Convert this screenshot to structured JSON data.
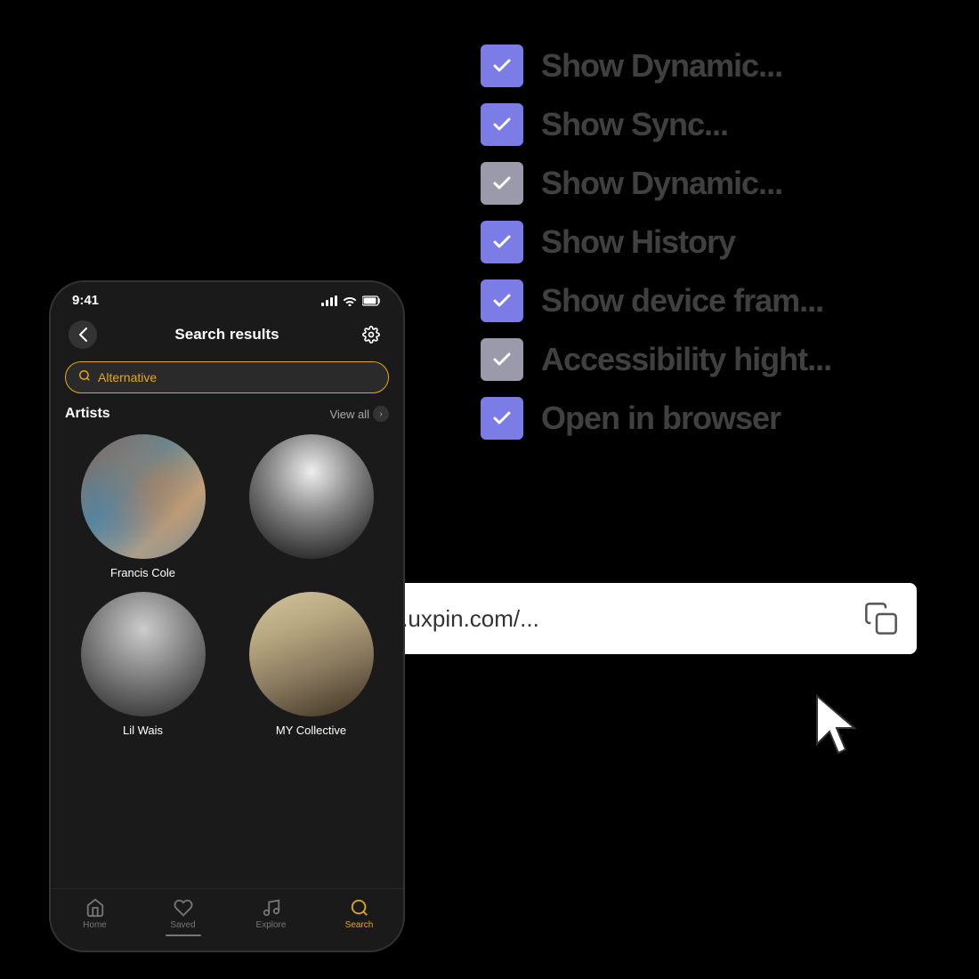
{
  "background": "#000000",
  "checkboxList": {
    "items": [
      {
        "id": 1,
        "label": "Show Dynamic...",
        "checked": true,
        "colorClass": "purple"
      },
      {
        "id": 2,
        "label": "Show Sync...",
        "checked": true,
        "colorClass": "purple"
      },
      {
        "id": 3,
        "label": "Show Dynamic...",
        "checked": true,
        "colorClass": "grey"
      },
      {
        "id": 4,
        "label": "Show History",
        "checked": true,
        "colorClass": "purple"
      },
      {
        "id": 5,
        "label": "Show device fram...",
        "checked": true,
        "colorClass": "purple"
      },
      {
        "id": 6,
        "label": "Accessibility hight...",
        "checked": true,
        "colorClass": "grey"
      },
      {
        "id": 7,
        "label": "Open in browser",
        "checked": true,
        "colorClass": "purple"
      }
    ]
  },
  "urlBar": {
    "url": "https://preview.uxpin.com/...",
    "copyIcon": "copy"
  },
  "phone": {
    "statusBar": {
      "time": "9:41",
      "signal": true,
      "wifi": true,
      "battery": true
    },
    "header": {
      "title": "Search results",
      "backButton": "‹",
      "settingsIcon": "⚙"
    },
    "searchBar": {
      "placeholder": "Alternative",
      "icon": "🔍"
    },
    "artists": {
      "sectionTitle": "Artists",
      "viewAll": "View all",
      "items": [
        {
          "name": "Francis Cole",
          "avatarType": "fc"
        },
        {
          "name": "",
          "avatarType": "b2"
        },
        {
          "name": "Lil Wais",
          "avatarType": "lw"
        },
        {
          "name": "MY Collective",
          "avatarType": "myc"
        }
      ]
    },
    "bottomNav": {
      "items": [
        {
          "label": "Home",
          "icon": "⌂",
          "active": false
        },
        {
          "label": "Saved",
          "icon": "♡",
          "active": false
        },
        {
          "label": "Explore",
          "icon": "♪",
          "active": false
        },
        {
          "label": "Search",
          "icon": "🔍",
          "active": true
        }
      ]
    }
  }
}
